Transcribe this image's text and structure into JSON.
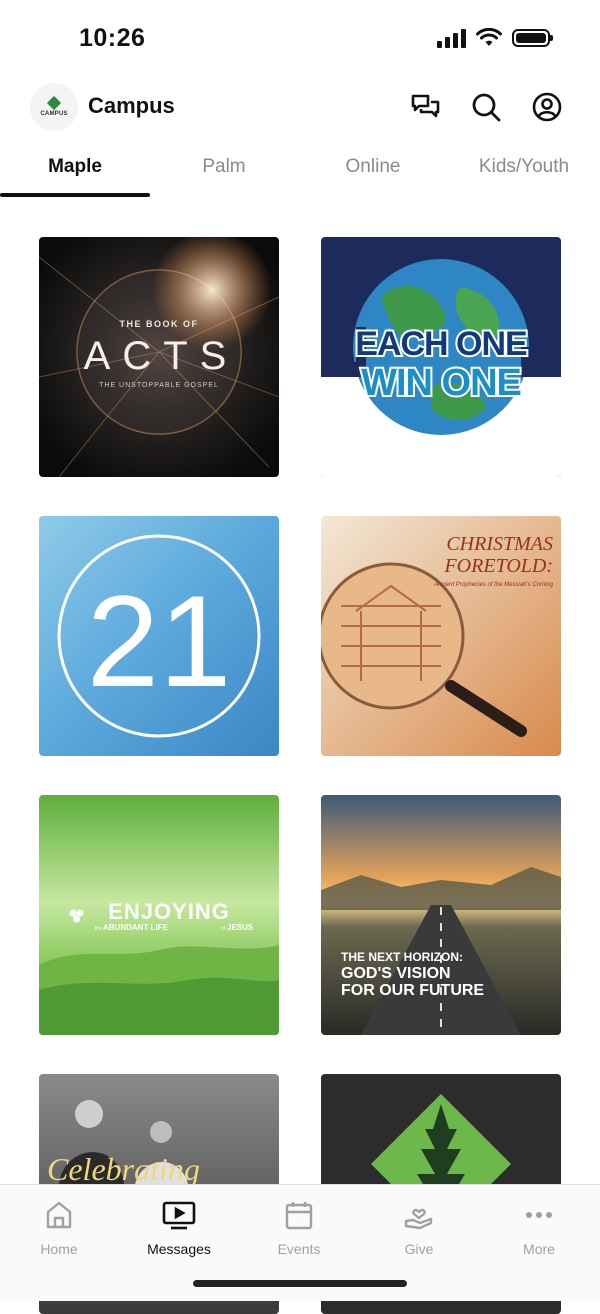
{
  "status_bar": {
    "time": "10:26"
  },
  "header": {
    "logo_text": "CAMPUS",
    "title": "Campus",
    "actions": [
      "chat-icon",
      "search-icon",
      "account-icon"
    ]
  },
  "tabs": [
    {
      "label": "Maple",
      "active": true
    },
    {
      "label": "Palm",
      "active": false
    },
    {
      "label": "Online",
      "active": false
    },
    {
      "label": "Kids/Youth",
      "active": false
    }
  ],
  "series": [
    {
      "title_line1": "THE BOOK OF",
      "title_line2": "ACTS",
      "subtitle": "THE UNSTOPPABLE GOSPEL"
    },
    {
      "title_line1": "EACH ONE",
      "title_line2": "WIN ONE"
    },
    {
      "title": "21"
    },
    {
      "title_line1": "CHRISTMAS",
      "title_line2": "FORETOLD:",
      "subtitle": "Ancient Prophecies of the Messiah's Coming"
    },
    {
      "title": "ENJOYING",
      "subtitle_pre": "the",
      "subtitle_mid": "ABUNDANT LIFE",
      "subtitle_of": "of",
      "subtitle_post": "JESUS"
    },
    {
      "title_line1": "THE NEXT HORIZON:",
      "title_line2": "GOD'S VISION",
      "title_line3": "FOR OUR FUTURE"
    },
    {
      "title": "Celebrating"
    },
    {
      "title": ""
    }
  ],
  "bottom_nav": [
    {
      "label": "Home",
      "icon": "home-icon",
      "active": false
    },
    {
      "label": "Messages",
      "icon": "messages-icon",
      "active": true
    },
    {
      "label": "Events",
      "icon": "calendar-icon",
      "active": false
    },
    {
      "label": "Give",
      "icon": "give-icon",
      "active": false
    },
    {
      "label": "More",
      "icon": "more-icon",
      "active": false
    }
  ]
}
